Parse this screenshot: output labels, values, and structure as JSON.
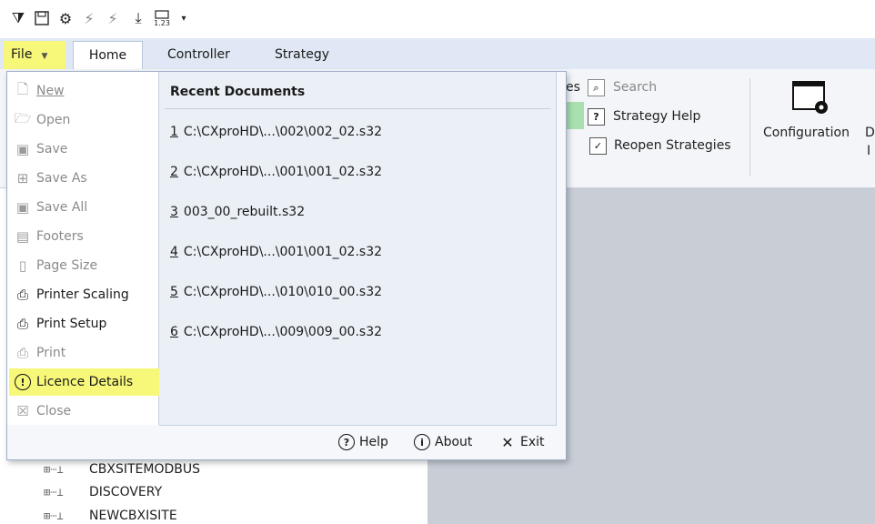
{
  "qat": {
    "icons": [
      "filter-icon",
      "save-icon",
      "gear-icon",
      "plug-icon",
      "plug-connect-icon",
      "download-icon",
      "format-123-icon",
      "customize-dropdown-icon"
    ],
    "format_label": "1.23"
  },
  "tabs": {
    "file": "File",
    "home": "Home",
    "controller": "Controller",
    "strategy": "Strategy"
  },
  "ribbon": {
    "partial_label": "es",
    "search": "Search",
    "strategy_help": "Strategy Help",
    "reopen_strategies": "Reopen Strategies",
    "reopen_checked": true,
    "configuration": "Configuration",
    "cut_label_1": "D",
    "cut_label_2": "I"
  },
  "file_menu": {
    "items": [
      {
        "label": "New",
        "icon": "new-document-icon",
        "enabled": false
      },
      {
        "label": "Open",
        "icon": "folder-open-icon",
        "enabled": false
      },
      {
        "label": "Save",
        "icon": "save-icon",
        "enabled": false
      },
      {
        "label": "Save As",
        "icon": "save-as-icon",
        "enabled": false
      },
      {
        "label": "Save All",
        "icon": "save-all-icon",
        "enabled": false
      },
      {
        "label": "Footers",
        "icon": "footer-icon",
        "enabled": false
      },
      {
        "label": "Page Size",
        "icon": "page-size-icon",
        "enabled": false
      },
      {
        "label": "Printer Scaling",
        "icon": "printer-scaling-icon",
        "enabled": true
      },
      {
        "label": "Print Setup",
        "icon": "print-setup-icon",
        "enabled": true
      },
      {
        "label": "Print",
        "icon": "print-icon",
        "enabled": false
      },
      {
        "label": "Licence Details",
        "icon": "licence-info-icon",
        "enabled": true,
        "highlighted": true
      },
      {
        "label": "Close",
        "icon": "close-document-icon",
        "enabled": false
      }
    ],
    "recent_title": "Recent Documents",
    "recent": [
      {
        "num": "1",
        "path": "C:\\CXproHD\\...\\002\\002_02.s32"
      },
      {
        "num": "2",
        "path": "C:\\CXproHD\\...\\001\\001_02.s32"
      },
      {
        "num": "3",
        "path": "003_00_rebuilt.s32"
      },
      {
        "num": "4",
        "path": "C:\\CXproHD\\...\\001\\001_02.s32"
      },
      {
        "num": "5",
        "path": "C:\\CXproHD\\...\\010\\010_00.s32"
      },
      {
        "num": "6",
        "path": "C:\\CXproHD\\...\\009\\009_00.s32"
      }
    ],
    "bottom": {
      "help": "Help",
      "about": "About",
      "exit": "Exit"
    }
  },
  "tree": {
    "items": [
      "CBXSITEMODBUS",
      "DISCOVERY",
      "NEWCBXISITE"
    ]
  }
}
